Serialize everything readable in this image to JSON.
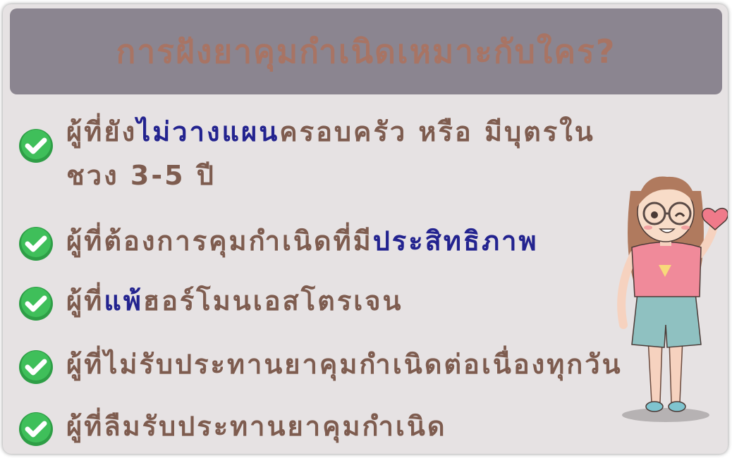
{
  "title": "การฝังยาคุมกำเนิดเหมาะกับใคร?",
  "items": [
    {
      "pre": "ผู้ที่ยัง",
      "hl": "ไม่วางแผน",
      "post": "ครอบครัว  หรือ  มีบุตรใน",
      "line2": "ชวง  3-5  ปี"
    },
    {
      "pre": "ผู้ที่ต้องการคุมกำเนิดที่มี",
      "hl": "ประสิทธิภาพ",
      "post": ""
    },
    {
      "pre": "ผู้ที่",
      "hl": "แพ้",
      "post": "ฮอร์โมนเอสโตรเจน"
    },
    {
      "pre": "ผู้ที่ไม่รับประทานยาคุมกำเนิดต่อเนื่องทุกวัน",
      "hl": "",
      "post": ""
    },
    {
      "pre": "ผู้ที่ลืมรับประทานยาคุมกำเนิด",
      "hl": "",
      "post": ""
    }
  ],
  "colors": {
    "card_bg": "#e6e2e3",
    "header_bg": "#8b8590",
    "title": "#a87464",
    "text": "#7e5c4f",
    "highlight": "#23238f",
    "check": "#3fbf5a"
  },
  "icons": [
    "check-circle-icon",
    "girl-illustration"
  ]
}
